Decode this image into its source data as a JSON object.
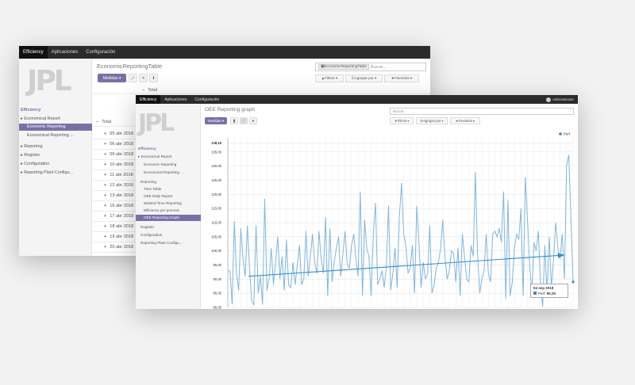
{
  "back_window": {
    "topbar_tabs": [
      "Efficiency",
      "Aplicaciones",
      "Configuración"
    ],
    "logo": "JPL",
    "title": "EconomicReportingTable",
    "search_facet": "EconomicReportingTable",
    "search_placeholder": "Buscar...",
    "buttons": {
      "medidas": "Medidas ▾",
      "filtros": "Filtros ▾",
      "agrupar": "Agrupar por ▾",
      "favoritos": "Favoritos ▾"
    },
    "sidebar": {
      "head": "Efficiency",
      "items": [
        "Economical Report",
        "Economic Reporting",
        "Economical Reporting ...",
        "Reporting",
        "Register",
        "Configuration",
        "Reporting Plant Configu..."
      ]
    },
    "table": {
      "top_total": "Total",
      "total": "Total",
      "rows": [
        "05 abr 2018",
        "06 abr 2018",
        "09 abr 2018",
        "10 abr 2018",
        "11 abr 2018",
        "12 abr 2018",
        "13 abr 2018",
        "16 abr 2018",
        "17 abr 2018",
        "18 abr 2018",
        "19 abr 2018",
        "20 abr 2018"
      ]
    }
  },
  "front_window": {
    "topbar_tabs": [
      "Efficiency",
      "Aplicaciones",
      "Configuración"
    ],
    "user": "Administrator",
    "logo": "JPL",
    "title": "OEE Reporting graph",
    "search_placeholder": "Buscar...",
    "buttons": {
      "medidas": "Medidas ▾",
      "filtros": "Filtros ▾",
      "agrupar": "Agrupar por ▾",
      "favoritos": "Favoritos ▾"
    },
    "sidebar": {
      "head": "Efficiency",
      "items": [
        "Economical Report",
        "Economic Reporting",
        "Economical Reporting ...",
        "Reporting",
        "Time Table",
        "OEE Daily Report",
        "Wasted Time Reporting",
        "Efficiency per process",
        "OEE Reporting Graph",
        "Register",
        "Configuration",
        "Reporting Plant Configu..."
      ]
    },
    "tooltip": {
      "date": "04 sep 2018",
      "series": "Perf",
      "value": "90,30"
    },
    "legend": "Perf"
  },
  "colors": {
    "accent": "#7c6fa9",
    "line": "#7fb6df",
    "trend": "#2e8fd0"
  },
  "chart_data": {
    "type": "line",
    "ylim": [
      80,
      140
    ],
    "y_ticks": [
      "80,00",
      "85,00",
      "90,00",
      "95,00",
      "100,00",
      "105,00",
      "110,00",
      "115,00",
      "120,00",
      "125,00",
      "130,00",
      "135,00",
      "138,18"
    ],
    "series": [
      {
        "name": "Perf",
        "values": [
          93.2,
          92.8,
          81.1,
          110.5,
          92,
          86,
          108,
          97,
          91,
          109,
          94,
          82.5,
          80.8,
          109,
          85,
          91,
          81,
          118.4,
          86,
          90,
          101,
          88,
          96,
          105,
          90,
          98,
          86,
          104,
          88,
          87,
          96,
          88,
          95,
          102,
          88,
          90,
          107,
          91,
          98,
          106,
          96,
          92,
          107,
          97,
          92,
          112,
          84,
          108,
          89,
          96,
          101,
          105,
          91,
          99,
          107,
          95,
          94,
          102,
          106,
          97,
          91,
          121,
          84,
          111,
          101,
          98,
          84,
          106,
          117,
          88,
          90,
          93,
          87,
          94,
          116,
          86,
          92,
          101,
          87,
          112,
          124,
          106,
          102,
          92,
          94,
          102,
          85,
          116,
          103,
          87,
          96,
          90,
          92,
          109,
          85,
          88,
          94,
          96,
          101,
          111,
          98,
          90,
          93,
          100,
          99,
          89,
          101,
          84,
          106,
          98,
          90,
          89,
          102,
          98,
          128,
          99,
          85,
          90,
          93,
          106,
          92,
          89,
          106,
          107,
          105,
          108,
          103,
          121,
          83,
          118,
          84,
          89,
          101,
          106,
          104,
          115,
          84,
          126,
          111,
          95,
          85,
          103,
          100,
          107,
          88,
          80.3,
          102,
          84,
          105,
          87,
          97,
          110,
          101,
          97,
          106,
          90,
          130,
          134,
          112,
          89
        ]
      }
    ],
    "trend": {
      "start": 91,
      "end": 98.5
    }
  }
}
